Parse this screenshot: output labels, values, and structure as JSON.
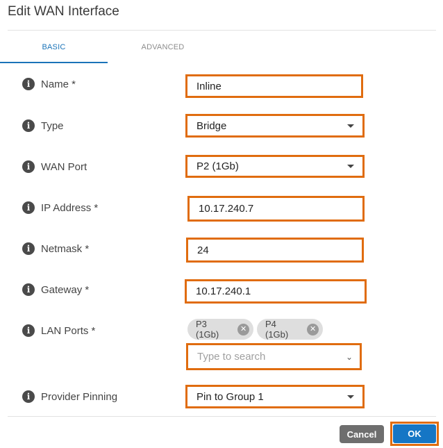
{
  "dialog": {
    "title": "Edit WAN Interface"
  },
  "tabs": [
    {
      "label": "BASIC",
      "active": true
    },
    {
      "label": "ADVANCED",
      "active": false
    }
  ],
  "fields": {
    "name": {
      "label": "Name *",
      "value": "Inline"
    },
    "type": {
      "label": "Type",
      "value": "Bridge"
    },
    "wan_port": {
      "label": "WAN Port",
      "value": "P2 (1Gb)"
    },
    "ip_address": {
      "label": "IP Address *",
      "value": "10.17.240.7"
    },
    "netmask": {
      "label": "Netmask *",
      "value": "24"
    },
    "gateway": {
      "label": "Gateway *",
      "value": "10.17.240.1"
    },
    "lan_ports": {
      "label": "LAN Ports *",
      "chips": [
        "P3 (1Gb)",
        "P4 (1Gb)"
      ],
      "placeholder": "Type to search"
    },
    "provider_pinning": {
      "label": "Provider Pinning",
      "value": "Pin to Group 1"
    }
  },
  "footer": {
    "cancel_label": "Cancel",
    "ok_label": "OK"
  },
  "colors": {
    "accent": "#1a73b8",
    "highlight": "#e06c0f",
    "ok_button": "#1576c5",
    "cancel_button": "#6e6e6e"
  },
  "icons": {
    "info": "info-icon",
    "dropdown": "caret-down-icon",
    "chip_remove": "close-circle-icon",
    "search_chevron": "chevron-down-icon"
  }
}
